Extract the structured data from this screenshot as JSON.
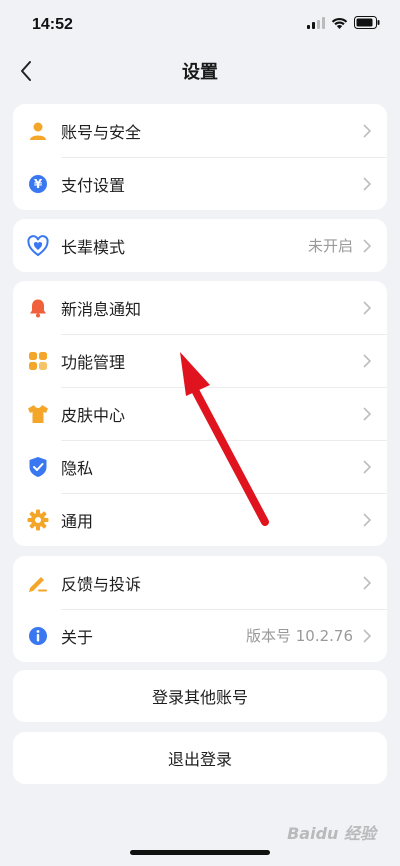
{
  "status": {
    "time": "14:52"
  },
  "nav": {
    "title": "设置"
  },
  "groups": [
    {
      "items": [
        {
          "label": "账号与安全",
          "icon": "person-icon",
          "value": ""
        },
        {
          "label": "支付设置",
          "icon": "yen-icon",
          "value": ""
        }
      ]
    },
    {
      "items": [
        {
          "label": "长辈模式",
          "icon": "heart-shield-icon",
          "value": "未开启"
        }
      ]
    },
    {
      "items": [
        {
          "label": "新消息通知",
          "icon": "bell-icon",
          "value": ""
        },
        {
          "label": "功能管理",
          "icon": "grid-icon",
          "value": ""
        },
        {
          "label": "皮肤中心",
          "icon": "shirt-icon",
          "value": ""
        },
        {
          "label": "隐私",
          "icon": "shield-check-icon",
          "value": ""
        },
        {
          "label": "通用",
          "icon": "gear-icon",
          "value": ""
        }
      ]
    },
    {
      "items": [
        {
          "label": "反馈与投诉",
          "icon": "pen-icon",
          "value": ""
        },
        {
          "label": "关于",
          "icon": "info-icon",
          "value": "版本号 10.2.76"
        }
      ]
    }
  ],
  "buttons": {
    "switch_account": "登录其他账号",
    "logout": "退出登录"
  },
  "watermark": "Baidu 经验",
  "colors": {
    "orange": "#f4a62a",
    "blue": "#3a78f2",
    "red": "#f0603c",
    "arrow": "#e0141e"
  }
}
